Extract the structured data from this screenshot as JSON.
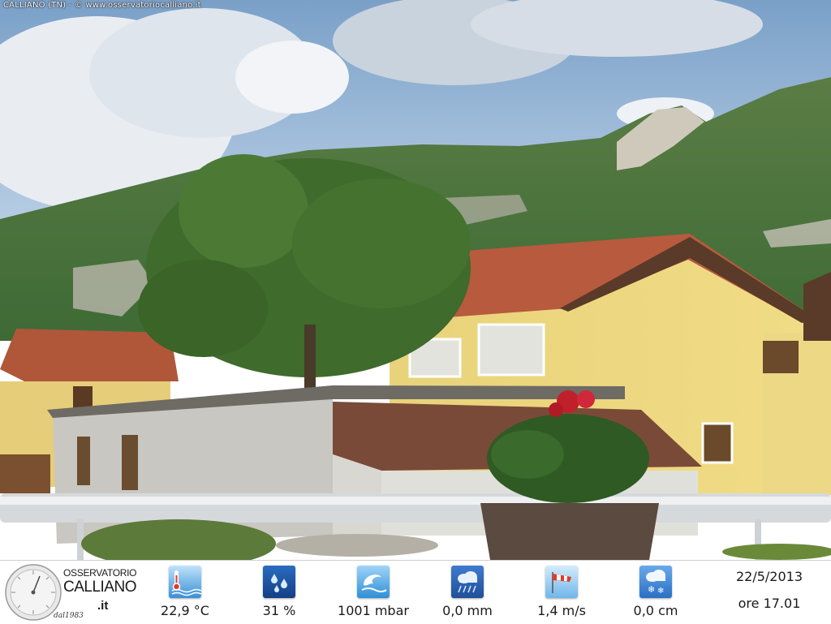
{
  "caption": "CALLIANO (TN) - © www.osservatoriocalliano.it",
  "logo": {
    "line1": "OSSERVATORIO",
    "line2": "CALLIANO",
    "suffix": ".it",
    "since": "dal1983"
  },
  "readings": [
    {
      "icon": "thermometer-water-icon",
      "value": "22,9 °C",
      "color": "#3a8fd6"
    },
    {
      "icon": "humidity-drops-icon",
      "value": "31 %",
      "color": "#1f5fb3"
    },
    {
      "icon": "pressure-wave-icon",
      "value": "1001 mbar",
      "color": "#2f8fd8"
    },
    {
      "icon": "rain-cloud-icon",
      "value": "0,0 mm",
      "color": "#2a64b8"
    },
    {
      "icon": "windsock-icon",
      "value": "1,4 m/s",
      "color": "#6fb6ea"
    },
    {
      "icon": "snow-cloud-icon",
      "value": "0,0 cm",
      "color": "#3f8ee0"
    }
  ],
  "date": "22/5/2013",
  "time": "ore 17.01"
}
